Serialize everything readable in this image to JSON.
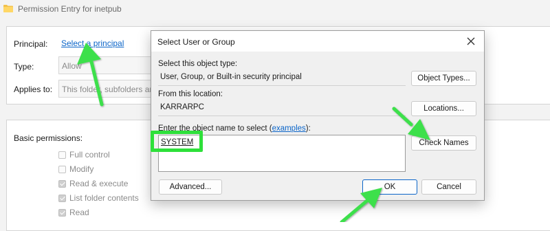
{
  "window": {
    "title": "Permission Entry for inetpub"
  },
  "principal": {
    "label": "Principal:",
    "link": "Select a principal"
  },
  "type": {
    "label": "Type:",
    "value": "Allow"
  },
  "applies_to": {
    "label": "Applies to:",
    "value": "This folder, subfolders and files"
  },
  "basic_permissions": {
    "label": "Basic permissions:",
    "items": [
      {
        "label": "Full control",
        "checked": false
      },
      {
        "label": "Modify",
        "checked": false
      },
      {
        "label": "Read & execute",
        "checked": true
      },
      {
        "label": "List folder contents",
        "checked": true
      },
      {
        "label": "Read",
        "checked": true
      }
    ]
  },
  "dialog": {
    "title": "Select User or Group",
    "object_type_label": "Select this object type:",
    "object_type_value": "User, Group, or Built-in security principal",
    "object_types_button": "Object Types...",
    "location_label": "From this location:",
    "location_value": "KARRARPC",
    "locations_button": "Locations...",
    "enter_name_label": "Enter the object name to select (",
    "examples_link": "examples",
    "enter_name_suffix": "):",
    "object_name_value": "SYSTEM",
    "check_names_button": "Check Names",
    "advanced_button": "Advanced...",
    "ok_button": "OK",
    "cancel_button": "Cancel"
  },
  "colors": {
    "highlight": "#2ee03a",
    "link": "#0a64c8",
    "default_button_border": "#0a64c8"
  },
  "icons": [
    "folder-icon",
    "close-icon",
    "arrow-annotation"
  ]
}
